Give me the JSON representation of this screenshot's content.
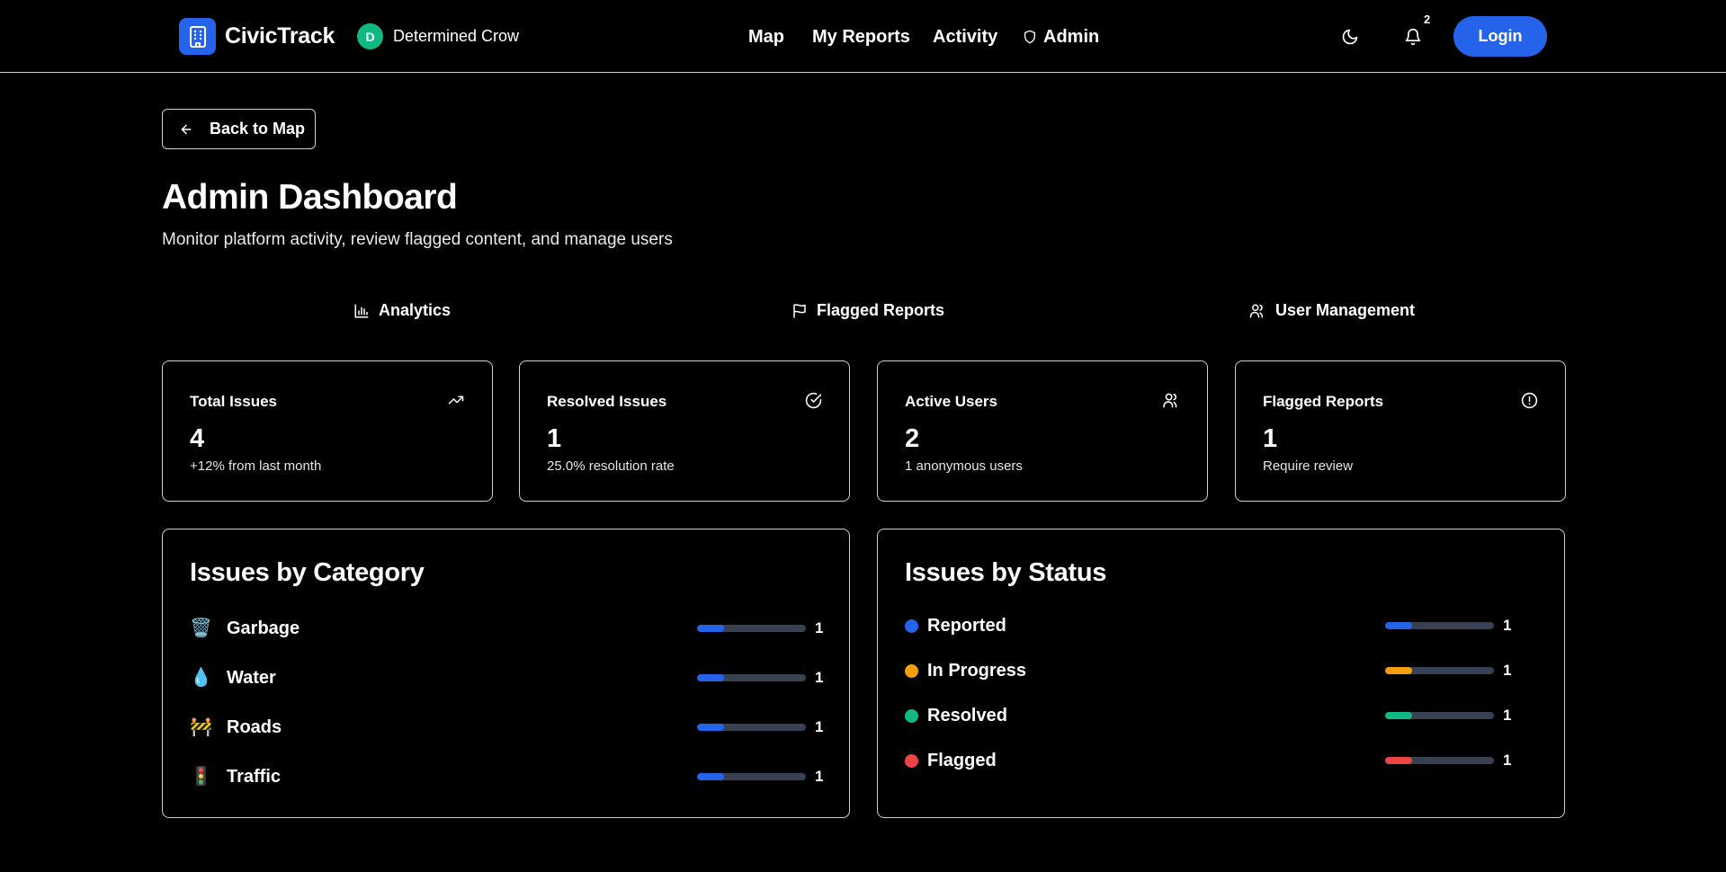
{
  "header": {
    "brand": "CivicTrack",
    "user": {
      "initial": "D",
      "name": "Determined Crow"
    },
    "nav": [
      "Map",
      "My Reports",
      "Activity",
      "Admin"
    ],
    "notifications_count": "2",
    "login_label": "Login",
    "icons": [
      "building-icon",
      "moon-icon",
      "bell-icon",
      "shield-icon"
    ]
  },
  "back_label": "Back to Map",
  "page": {
    "title": "Admin Dashboard",
    "subtitle": "Monitor platform activity, review flagged content, and manage users"
  },
  "tabs": [
    "Analytics",
    "Flagged Reports",
    "User Management"
  ],
  "stats": [
    {
      "label": "Total Issues",
      "value": "4",
      "note": "+12% from last month",
      "icon": "trending-up-icon"
    },
    {
      "label": "Resolved Issues",
      "value": "1",
      "note": "25.0% resolution rate",
      "icon": "check-circle-icon"
    },
    {
      "label": "Active Users",
      "value": "2",
      "note": "1 anonymous users",
      "icon": "users-icon"
    },
    {
      "label": "Flagged Reports",
      "value": "1",
      "note": "Require review",
      "icon": "alert-circle-icon"
    }
  ],
  "category_panel": {
    "title": "Issues by Category",
    "items": [
      {
        "emoji": "🗑️",
        "label": "Garbage",
        "count": "1",
        "fraction": 0.25
      },
      {
        "emoji": "💧",
        "label": "Water",
        "count": "1",
        "fraction": 0.25
      },
      {
        "emoji": "🚧",
        "label": "Roads",
        "count": "1",
        "fraction": 0.25
      },
      {
        "emoji": "🚦",
        "label": "Traffic",
        "count": "1",
        "fraction": 0.25
      }
    ]
  },
  "status_panel": {
    "title": "Issues by Status",
    "items": [
      {
        "label": "Reported",
        "count": "1",
        "fraction": 0.25,
        "color": "#2563eb"
      },
      {
        "label": "In Progress",
        "count": "1",
        "fraction": 0.25,
        "color": "#f59e0b"
      },
      {
        "label": "Resolved",
        "count": "1",
        "fraction": 0.25,
        "color": "#10b981"
      },
      {
        "label": "Flagged",
        "count": "1",
        "fraction": 0.25,
        "color": "#ef4444"
      }
    ]
  },
  "colors": {
    "accent": "#2563eb",
    "avatar": "#10b981",
    "track": "#374151"
  }
}
